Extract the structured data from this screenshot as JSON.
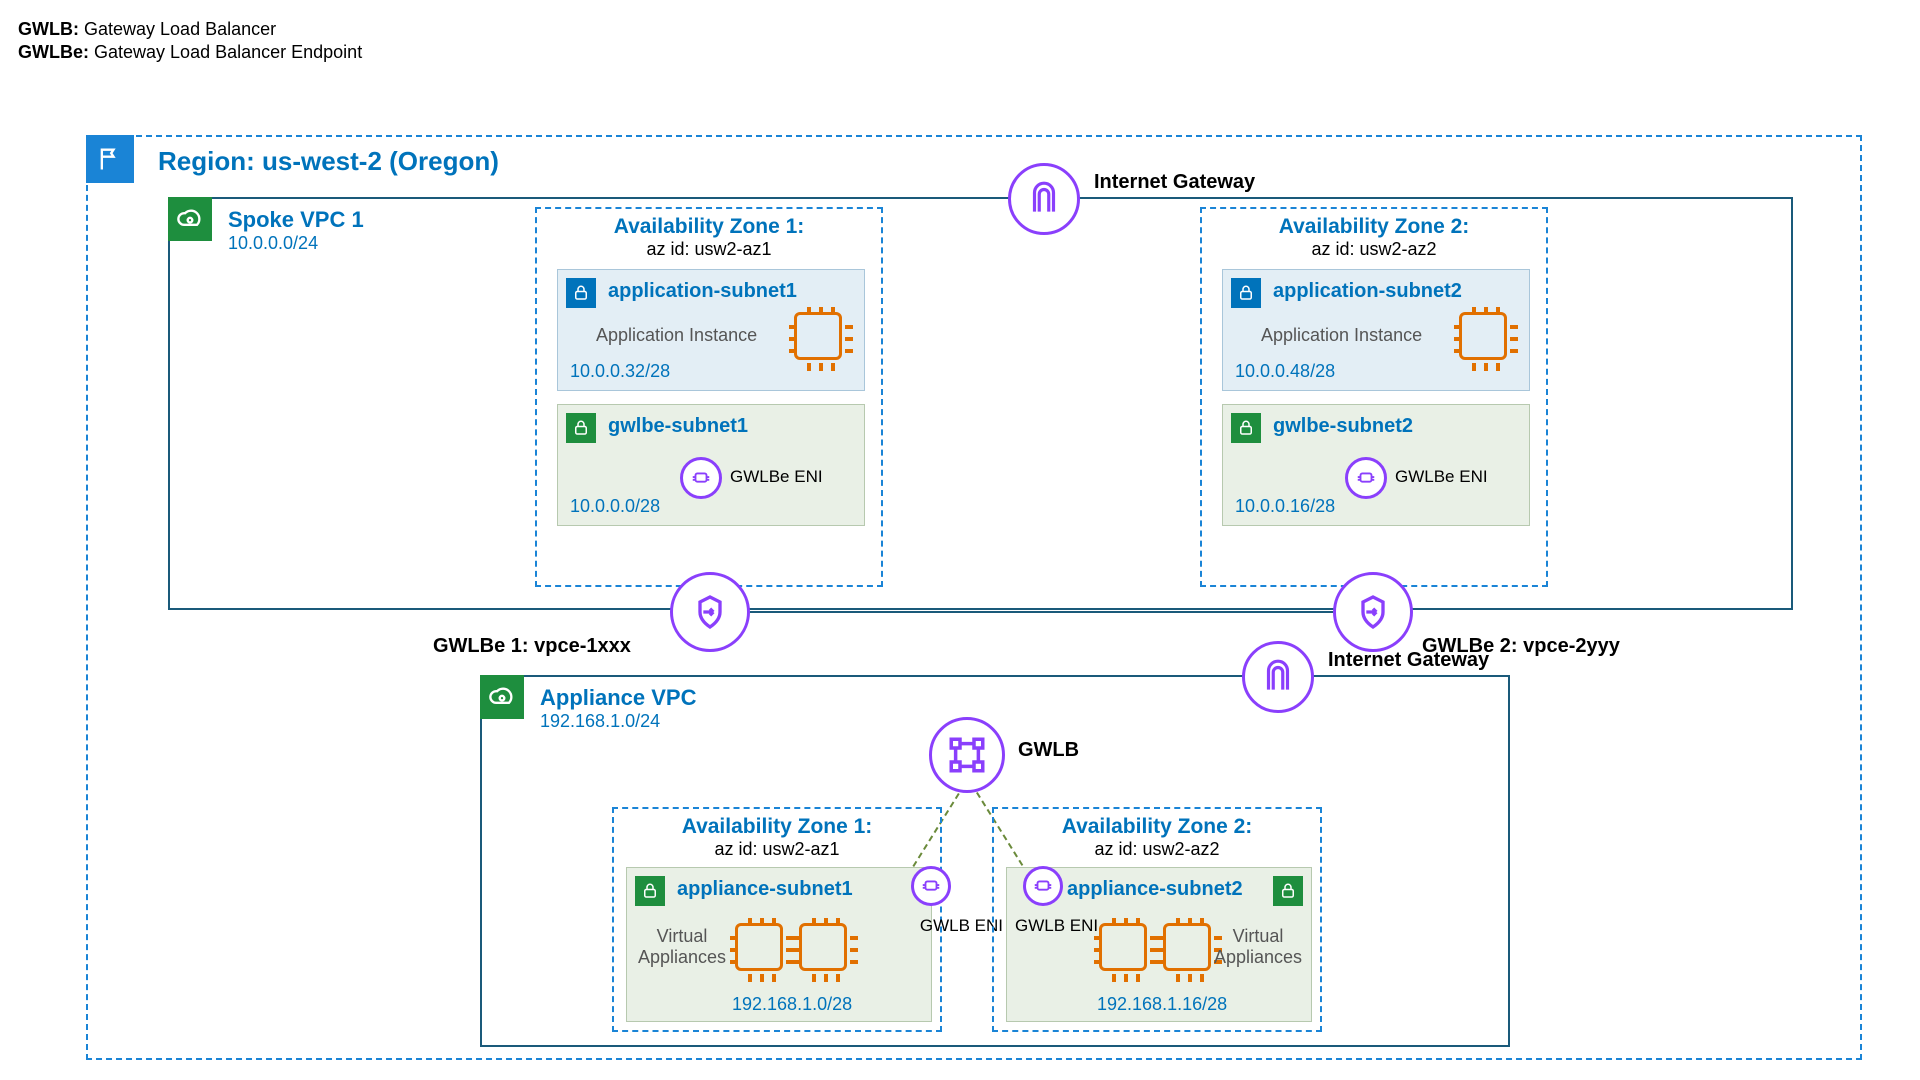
{
  "legend": {
    "gwlb_key": "GWLB:",
    "gwlb_val": "Gateway Load Balancer",
    "gwlbe_key": "GWLBe:",
    "gwlbe_val": "Gateway Load Balancer Endpoint"
  },
  "region": {
    "title": "Region: us-west-2 (Oregon)"
  },
  "igw_label": "Internet Gateway",
  "spoke": {
    "title": "Spoke VPC 1",
    "cidr": "10.0.0.0/24",
    "az1": {
      "title": "Availability Zone 1:",
      "id_label": "az id: usw2-az1",
      "app_subnet": {
        "name": "application-subnet1",
        "instance_label": "Application Instance",
        "cidr": "10.0.0.32/28"
      },
      "gwlbe_subnet": {
        "name": "gwlbe-subnet1",
        "eni_label": "GWLBe ENI",
        "cidr": "10.0.0.0/28"
      }
    },
    "az2": {
      "title": "Availability Zone 2:",
      "id_label": "az id: usw2-az2",
      "app_subnet": {
        "name": "application-subnet2",
        "instance_label": "Application Instance",
        "cidr": "10.0.0.48/28"
      },
      "gwlbe_subnet": {
        "name": "gwlbe-subnet2",
        "eni_label": "GWLBe ENI",
        "cidr": "10.0.0.16/28"
      }
    },
    "gwlbe1_label": "GWLBe 1: vpce-1xxx",
    "gwlbe2_label": "GWLBe 2: vpce-2yyy"
  },
  "gwlb_label": "GWLB",
  "appliance": {
    "title": "Appliance VPC",
    "cidr": "192.168.1.0/24",
    "az1": {
      "title": "Availability Zone 1:",
      "id_label": "az id: usw2-az1",
      "subnet": {
        "name": "appliance-subnet1",
        "va_label": "Virtual Appliances",
        "eni_label": "GWLB ENI",
        "cidr": "192.168.1.0/28"
      }
    },
    "az2": {
      "title": "Availability Zone 2:",
      "id_label": "az id: usw2-az2",
      "subnet": {
        "name": "appliance-subnet2",
        "va_label": "Virtual Appliances",
        "eni_label": "GWLB ENI",
        "cidr": "192.168.1.16/28"
      }
    }
  }
}
